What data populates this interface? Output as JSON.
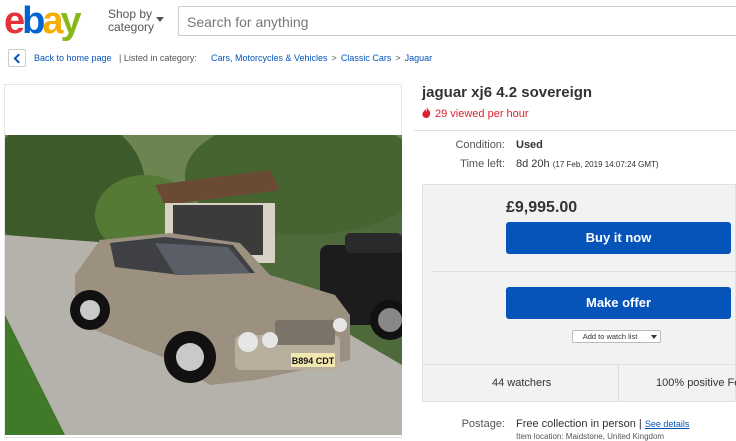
{
  "header": {
    "logo_letters": [
      "e",
      "b",
      "a",
      "y"
    ],
    "logo_colors": [
      "#e53238",
      "#0064d2",
      "#f5af02",
      "#86b817"
    ],
    "shop_by_line1": "Shop by",
    "shop_by_line2": "category",
    "search_placeholder": "Search for anything"
  },
  "breadcrumb": {
    "back_label": "Back to home page",
    "listed_in": "| Listed in category:",
    "path": [
      "Cars, Motorcycles & Vehicles",
      "Classic Cars",
      "Jaguar"
    ],
    "separator": ">"
  },
  "listing": {
    "title": "jaguar xj6 4.2 sovereign",
    "views": "29 viewed per hour",
    "condition_label": "Condition:",
    "condition_value": "Used",
    "time_left_label": "Time left:",
    "time_left_value": "8d 20h",
    "time_left_detail": "(17 Feb, 2019  14:07:24 GMT)",
    "price": "£9,995.00",
    "buy_now_label": "Buy it now",
    "make_offer_label": "Make offer",
    "watch_label": "Add to watch list",
    "watchers": "44 watchers",
    "positive": "100% positive Fe",
    "postage_label": "Postage:",
    "postage_value": "Free collection in person |",
    "see_details": "See details",
    "item_location": "Item location:  Maidstone, United Kingdom",
    "plate": "B894 CDT"
  },
  "colors": {
    "link": "#0654ba",
    "button": "#0654ba",
    "alert": "#dd1e31"
  }
}
